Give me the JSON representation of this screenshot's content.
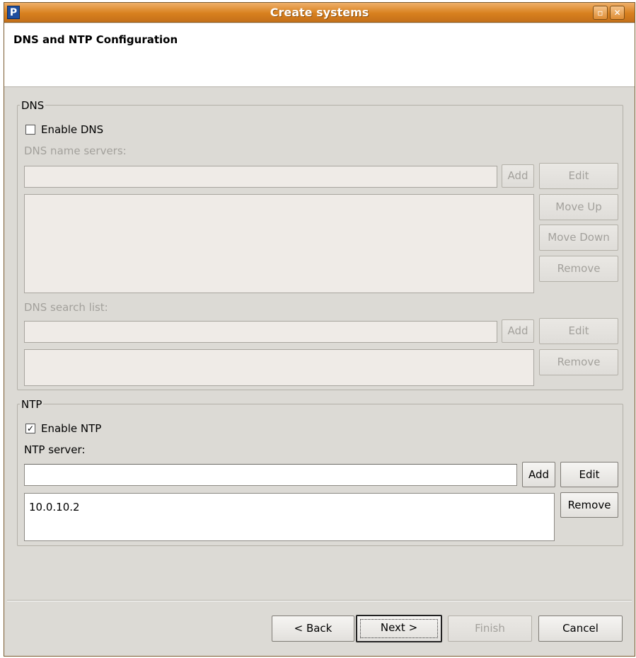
{
  "window": {
    "title": "Create systems",
    "app_icon_letter": "P",
    "maximize_glyph": "▫",
    "close_glyph": "✕"
  },
  "header": {
    "title": "DNS and NTP Configuration"
  },
  "dns": {
    "group_label": "DNS",
    "enable_label": "Enable DNS",
    "enabled": false,
    "name_servers_label": "DNS name servers:",
    "name_server_input_value": "",
    "add_label": "Add",
    "edit_label": "Edit",
    "move_up_label": "Move Up",
    "move_down_label": "Move Down",
    "remove_label": "Remove",
    "search_list_label": "DNS search list:",
    "search_input_value": "",
    "search_add_label": "Add",
    "search_edit_label": "Edit",
    "search_remove_label": "Remove"
  },
  "ntp": {
    "group_label": "NTP",
    "enable_label": "Enable NTP",
    "enabled": true,
    "checkmark": "✓",
    "server_label": "NTP server:",
    "server_input_value": "",
    "add_label": "Add",
    "edit_label": "Edit",
    "remove_label": "Remove",
    "servers": [
      "10.0.10.2"
    ]
  },
  "footer": {
    "back_label": "< Back",
    "next_label": "Next >",
    "finish_label": "Finish",
    "cancel_label": "Cancel"
  }
}
